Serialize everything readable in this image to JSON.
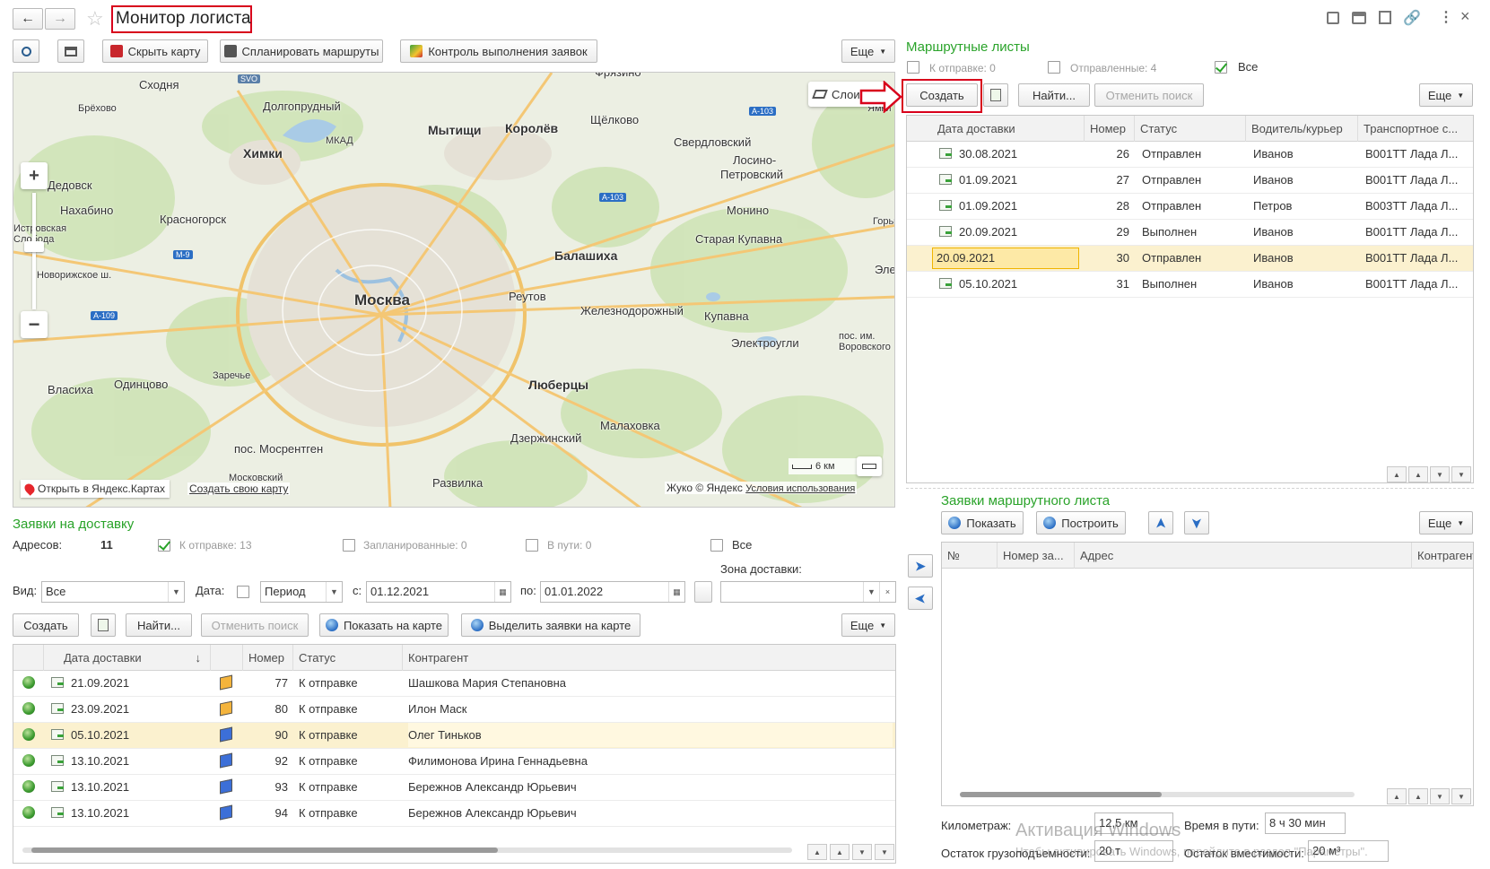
{
  "window": {
    "title": "Монитор логиста"
  },
  "left_toolbar": {
    "hide_map": "Скрыть карту",
    "plan_routes": "Спланировать маршруты",
    "control": "Контроль выполнения заявок",
    "more": "Еще"
  },
  "map": {
    "layers_label": "Слои",
    "scale_label": "6 км",
    "open_yandex": "Открыть в Яндекс.Картах",
    "create_map": "Создать свою карту",
    "copyright": "Жуко © Яндекс",
    "terms": "Условия использования",
    "places": [
      {
        "name": "Фрязино"
      },
      {
        "name": "Сходня"
      },
      {
        "name": "SVO"
      },
      {
        "name": "Брёхово"
      },
      {
        "name": "Долгопрудный"
      },
      {
        "name": "Мытищи"
      },
      {
        "name": "Королёв"
      },
      {
        "name": "Щёлково"
      },
      {
        "name": "Ямки"
      },
      {
        "name": "Химки"
      },
      {
        "name": "Свердловский"
      },
      {
        "name": "Лосино-"
      },
      {
        "name": "Петровский"
      },
      {
        "name": "Дедовск"
      },
      {
        "name": "Нахабино"
      },
      {
        "name": "Красногорск"
      },
      {
        "name": "Монино"
      },
      {
        "name": "Горьк"
      },
      {
        "name": "Балашиха"
      },
      {
        "name": "Старая Купавна"
      },
      {
        "name": "Эле"
      },
      {
        "name": "Москва"
      },
      {
        "name": "Реутов"
      },
      {
        "name": "Железнодорожный"
      },
      {
        "name": "Купавна"
      },
      {
        "name": "Электроугли"
      },
      {
        "name": "пос. им."
      },
      {
        "name": "Воровского"
      },
      {
        "name": "Заречье"
      },
      {
        "name": "Власиха"
      },
      {
        "name": "Одинцово"
      },
      {
        "name": "Люберцы"
      },
      {
        "name": "Малаховка"
      },
      {
        "name": "Дзержинский"
      },
      {
        "name": "пос. Мосрентген"
      },
      {
        "name": "Развилка"
      },
      {
        "name": "Московский"
      },
      {
        "name": "Новорижское ш."
      },
      {
        "name": "Истровская"
      },
      {
        "name": "Слобода"
      },
      {
        "name": "МКАД"
      },
      {
        "name": "А-103"
      },
      {
        "name": "М-9"
      },
      {
        "name": "А-109"
      }
    ]
  },
  "deliveries": {
    "title": "Заявки на доставку",
    "addresses_label": "Адресов:",
    "addresses_value": "11",
    "filters": {
      "to_send": "К отправке: 13",
      "planned": "Запланированные: 0",
      "in_transit": "В пути: 0",
      "all": "Все"
    },
    "view_label": "Вид:",
    "view_value": "Все",
    "date_label": "Дата:",
    "period_value": "Период",
    "from_label": "с:",
    "from_value": "01.12.2021",
    "to_label": "по:",
    "to_value": "01.01.2022",
    "zone_label": "Зона доставки:",
    "toolbar": {
      "create": "Создать",
      "find": "Найти...",
      "cancel_search": "Отменить поиск",
      "show_on_map": "Показать на карте",
      "highlight": "Выделить заявки на карте",
      "more": "Еще"
    },
    "columns": {
      "date": "Дата доставки",
      "number": "Номер",
      "status": "Статус",
      "contractor": "Контрагент"
    },
    "rows": [
      {
        "date": "21.09.2021",
        "box": "#f4b43c",
        "number": "77",
        "status": "К отправке",
        "contractor": "Шашкова Мария Степановна"
      },
      {
        "date": "23.09.2021",
        "box": "#f4b43c",
        "number": "80",
        "status": "К отправке",
        "contractor": "Илон Маск"
      },
      {
        "date": "05.10.2021",
        "box": "#3c6fd8",
        "number": "90",
        "status": "К отправке",
        "contractor": "Олег Тиньков"
      },
      {
        "date": "13.10.2021",
        "box": "#3c6fd8",
        "number": "92",
        "status": "К отправке",
        "contractor": "Филимонова Ирина Геннадьевна"
      },
      {
        "date": "13.10.2021",
        "box": "#3c6fd8",
        "number": "93",
        "status": "К отправке",
        "contractor": "Бережнов Александр Юрьевич"
      },
      {
        "date": "13.10.2021",
        "box": "#3c6fd8",
        "number": "94",
        "status": "К отправке",
        "contractor": "Бережнов Александр Юрьевич"
      }
    ]
  },
  "routes": {
    "title": "Маршрутные листы",
    "filters": {
      "to_send": "К отправке: 0",
      "sent": "Отправленные: 4",
      "all": "Все"
    },
    "toolbar": {
      "create": "Создать",
      "find": "Найти...",
      "cancel_search": "Отменить поиск",
      "more": "Еще"
    },
    "columns": {
      "date": "Дата доставки",
      "number": "Номер",
      "status": "Статус",
      "driver": "Водитель/курьер",
      "vehicle": "Транспортное с..."
    },
    "rows": [
      {
        "date": "30.08.2021",
        "number": "26",
        "status": "Отправлен",
        "driver": "Иванов",
        "vehicle": "В001ТТ Лада Л..."
      },
      {
        "date": "01.09.2021",
        "number": "27",
        "status": "Отправлен",
        "driver": "Иванов",
        "vehicle": "В001ТТ Лада Л..."
      },
      {
        "date": "01.09.2021",
        "number": "28",
        "status": "Отправлен",
        "driver": "Петров",
        "vehicle": "В003ТТ Лада Л..."
      },
      {
        "date": "20.09.2021",
        "number": "29",
        "status": "Выполнен",
        "driver": "Иванов",
        "vehicle": "В001ТТ Лада Л..."
      },
      {
        "date": "20.09.2021",
        "number": "30",
        "status": "Отправлен",
        "driver": "Иванов",
        "vehicle": "В001ТТ Лада Л..."
      },
      {
        "date": "05.10.2021",
        "number": "31",
        "status": "Выполнен",
        "driver": "Иванов",
        "vehicle": "В001ТТ Лада Л..."
      }
    ]
  },
  "route_requests": {
    "title": "Заявки маршрутного листа",
    "toolbar": {
      "show": "Показать",
      "build": "Построить",
      "more": "Еще"
    },
    "columns": {
      "no": "№",
      "request_number": "Номер за...",
      "address": "Адрес",
      "contractor": "Контрагент"
    }
  },
  "footer": {
    "mileage_label": "Километраж:",
    "mileage_value": "12,5 км",
    "travel_time_label": "Время в пути:",
    "travel_time_value": "8 ч 30 мин",
    "load_label": "Остаток грузоподъемности:",
    "load_value": "20 т",
    "volume_label": "Остаток вместимости:",
    "volume_value": "20 м³"
  },
  "watermark": {
    "line1": "Активация Windows",
    "line2": "Чтобы активировать Windows, перейдите в раздел \"Параметры\"."
  },
  "colors": {
    "accent_green": "#2aa32a",
    "highlight_red": "#d8001b",
    "selected_row": "#fbf1cf"
  }
}
